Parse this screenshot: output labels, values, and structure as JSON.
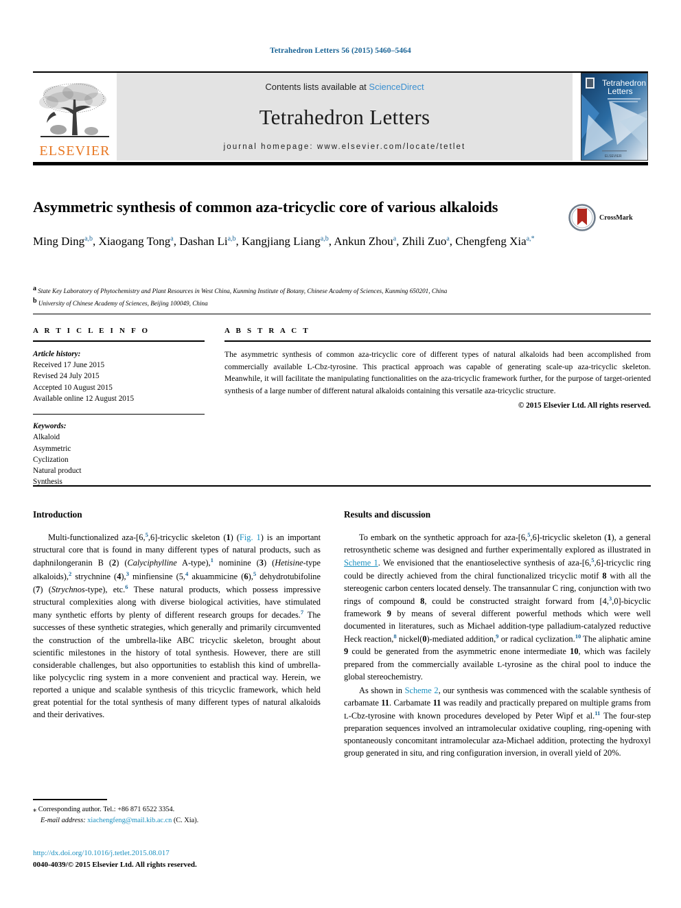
{
  "running_head": "Tetrahedron Letters 56 (2015) 5460–5464",
  "masthead": {
    "publisher_name": "ELSEVIER",
    "contents_prefix": "Contents lists available at ",
    "contents_link": "ScienceDirect",
    "journal_title": "Tetrahedron Letters",
    "homepage_prefix": "journal homepage: ",
    "homepage_url": "www.elsevier.com/locate/tetlet",
    "cover_title_line1": "Tetrahedron",
    "cover_title_line2": "Letters",
    "cover_publisher": "ELSEVIER"
  },
  "article": {
    "title": "Asymmetric synthesis of common aza-tricyclic core of various alkaloids",
    "crossmark_label": "CrossMark",
    "authors": [
      {
        "name": "Ming Ding",
        "sup": "a,b",
        "sep": ", "
      },
      {
        "name": "Xiaogang Tong",
        "sup": "a",
        "sep": ", "
      },
      {
        "name": "Dashan Li",
        "sup": "a,b",
        "sep": ", "
      },
      {
        "name": "Kangjiang Liang",
        "sup": "a,b",
        "sep": ", "
      },
      {
        "name": "Ankun Zhou",
        "sup": "a",
        "sep": ", "
      },
      {
        "name": "Zhili Zuo",
        "sup": "a",
        "sep": ", "
      },
      {
        "name": "Chengfeng Xia",
        "sup": "a,*",
        "sep": ""
      }
    ],
    "affiliations": [
      {
        "sup": "a",
        "text": "State Key Laboratory of Phytochemistry and Plant Resources in West China, Kunming Institute of Botany, Chinese Academy of Sciences, Kunming 650201, China"
      },
      {
        "sup": "b",
        "text": "University of Chinese Academy of Sciences, Beijing 100049, China"
      }
    ]
  },
  "article_info": {
    "heading": "A R T I C L E    I N F O",
    "history_label": "Article history:",
    "history": [
      "Received 17 June 2015",
      "Revised 24 July 2015",
      "Accepted 10 August 2015",
      "Available online 12 August 2015"
    ],
    "keywords_label": "Keywords:",
    "keywords": [
      "Alkaloid",
      "Asymmetric",
      "Cyclization",
      "Natural product",
      "Synthesis"
    ]
  },
  "abstract": {
    "heading": "A B S T R A C T",
    "text": "The asymmetric synthesis of common aza-tricyclic core of different types of natural alkaloids had been accomplished from commercially available L-Cbz-tyrosine. This practical approach was capable of generating scale-up aza-tricyclic skeleton. Meanwhile, it will facilitate the manipulating functionalities on the aza-tricyclic framework further, for the purpose of target-oriented synthesis of a large number of different natural alkaloids containing this versatile aza-tricyclic structure.",
    "copyright": "© 2015 Elsevier Ltd. All rights reserved."
  },
  "body": {
    "left_heading": "Introduction",
    "right_heading": "Results and discussion",
    "intro_paragraph_pre_fig": "Multi-functionalized aza-[6,5,6]-tricyclic skeleton (1) (",
    "intro_fig_link": "Fig. 1",
    "intro_paragraph_rest": ") is an important structural core that is found in many different types of natural products, such as daphnilongeranin B (2) (Calyciphylline A-type),1 nominine (3) (Hetisine-type alkaloids),2 strychnine (4),3 minfiensine (5,4 akuammicine (6),5 dehydrotubifoline (7) (Strychnos-type), etc.6 These natural products, which possess impressive structural complexities along with diverse biological activities, have stimulated many synthetic efforts by plenty of different research groups for decades.7 The successes of these synthetic strategies, which generally and primarily circumvented the construction of the umbrella-like ABC tricyclic skeleton, brought about scientific milestones in the history of total synthesis. However, there are still considerable challenges, but also opportunities to establish this kind of umbrella-like polycyclic ring system in a more convenient and practical way. Herein, we reported a unique and scalable synthesis of this tricyclic framework, which held great potential for the total synthesis of many different types of natural alkaloids and their derivatives.",
    "results_p1_a": "To embark on the synthetic approach for aza-[6,5,6]-tricyclic skeleton (1), a general retrosynthetic scheme was designed and further experimentally explored as illustrated in ",
    "results_p1_link": "Scheme 1",
    "results_p1_b": ". We envisioned that the enantioselective synthesis of aza-[6,5,6]-tricyclic ring could be directly achieved from the chiral functionalized tricyclic motif 8 with all the stereogenic carbon centers located densely. The transannular C ring, conjunction with two rings of compound 8, could be constructed straight forward from [4,3,0]-bicyclic framework 9 by means of several different powerful methods which were well documented in literatures, such as Michael addition-type palladium-catalyzed reductive Heck reaction,8 nickel(0)-mediated addition,9 or radical cyclization.10 The aliphatic amine 9 could be generated from the asymmetric enone intermediate 10, which was facilely prepared from the commercially available L-tyrosine as the chiral pool to induce the global stereochemistry.",
    "results_p2_a": "As shown in ",
    "results_p2_link": "Scheme 2",
    "results_p2_b": ", our synthesis was commenced with the scalable synthesis of carbamate 11. Carbamate 11 was readily and practically prepared on multiple grams from L-Cbz-tyrosine with known procedures developed by Peter Wipf et al.11 The four-step preparation sequences involved an intramolecular oxidative coupling, ring-opening with spontaneously concomitant intramolecular aza-Michael addition, protecting the hydroxyl group generated in situ, and ring configuration inversion, in overall yield of 20%."
  },
  "footer": {
    "corresponding_marker": "⁎",
    "corresponding_text": "Corresponding author. Tel.: +86 871 6522 3354.",
    "email_label": "E-mail address:",
    "email": "xiachengfeng@mail.kib.ac.cn",
    "email_suffix": "(C. Xia).",
    "doi": "http://dx.doi.org/10.1016/j.tetlet.2015.08.017",
    "issn_line": "0040-4039/© 2015 Elsevier Ltd. All rights reserved."
  },
  "colors": {
    "link_blue": "#1a8fbf",
    "header_blue": "#1a6496",
    "elsevier_orange": "#E87722",
    "masthead_grey": "#e3e3e3"
  }
}
